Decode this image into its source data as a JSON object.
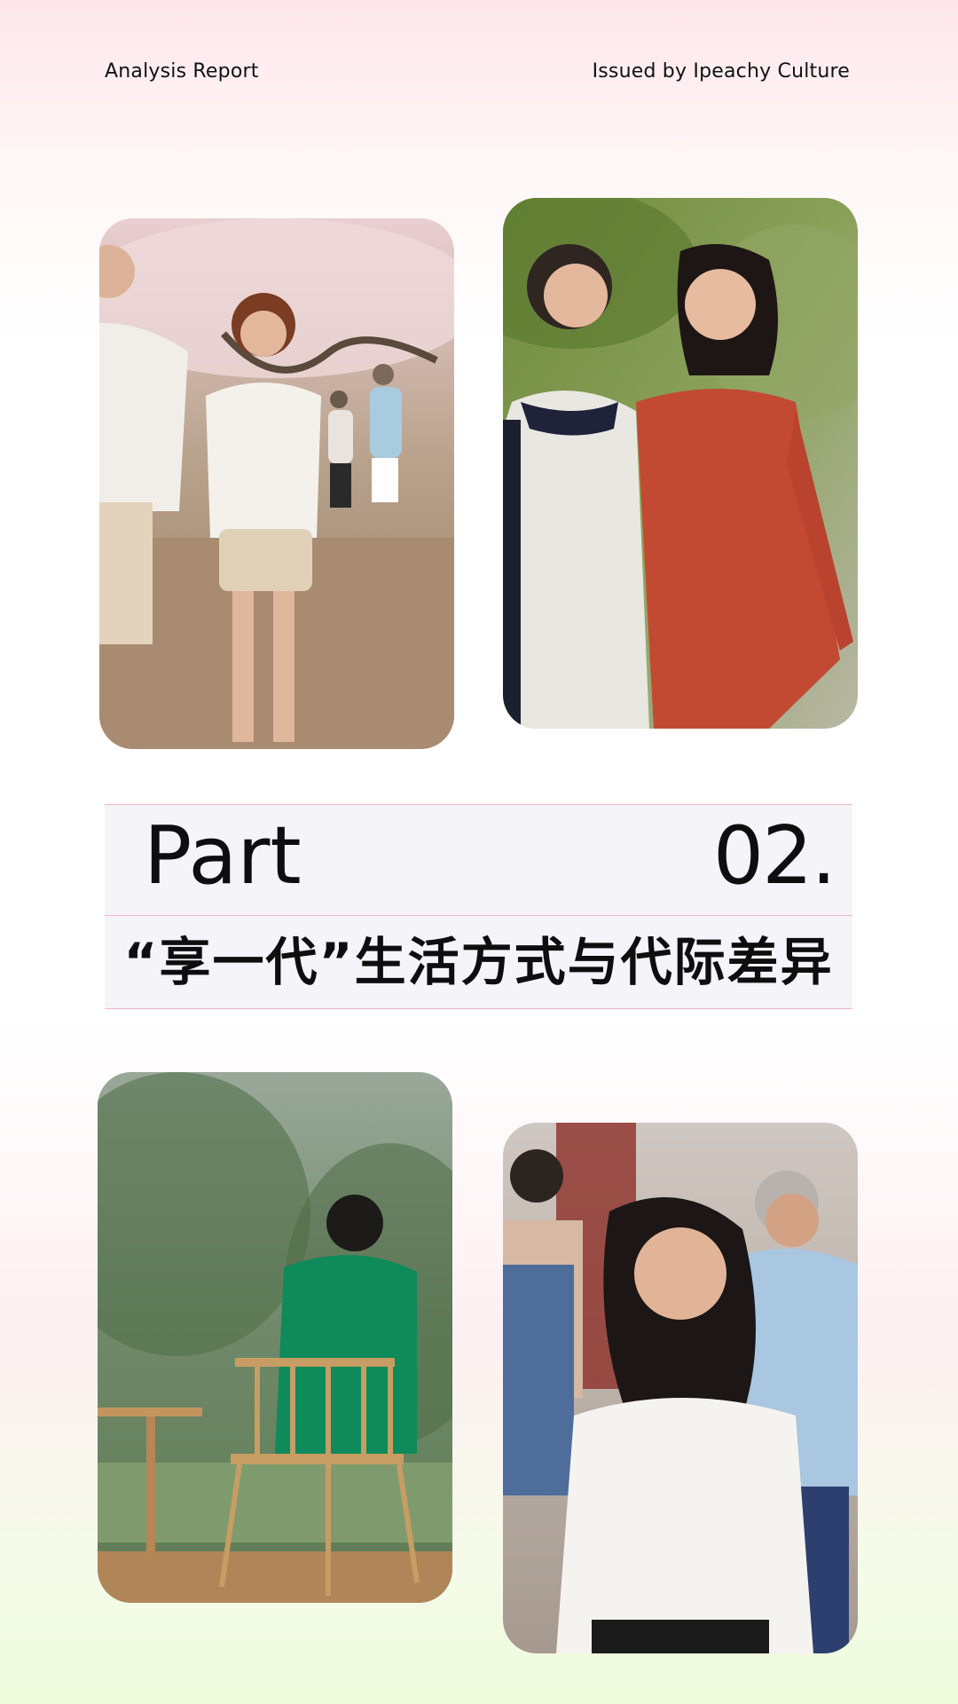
{
  "header": {
    "left": "Analysis Report",
    "right": "Issued by Ipeachy Culture"
  },
  "section": {
    "part_label": "Part",
    "part_number": "02.",
    "subtitle": "“享一代”生活方式与代际差异"
  },
  "photos": [
    {
      "subject": "older adults jogging in park under blossom trees"
    },
    {
      "subject": "two older women laughing while walking outdoors"
    },
    {
      "subject": "woman in green coat sitting on wooden chair facing trees"
    },
    {
      "subject": "group of older adults dancing and laughing"
    }
  ],
  "colors": {
    "accent_line": "#f3b6c5",
    "band_bg": "#f5f4f8",
    "text": "#0e0e10"
  }
}
